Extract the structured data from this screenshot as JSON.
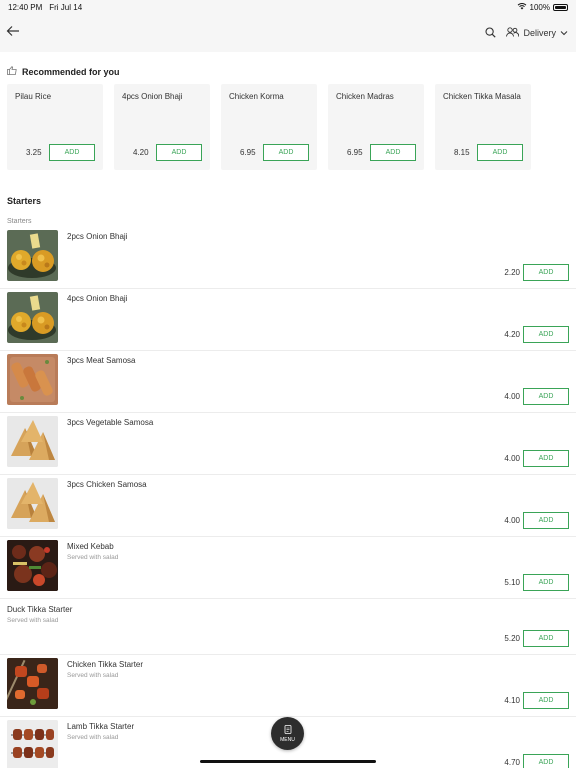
{
  "status_bar": {
    "time": "12:40 PM",
    "date": "Fri Jul 14",
    "battery": "100%",
    "battery_level": 1.0
  },
  "nav": {
    "delivery_label": "Delivery"
  },
  "recommended": {
    "title": "Recommended for you",
    "items": [
      {
        "name": "Pilau Rice",
        "price": "3.25",
        "add_label": "ADD"
      },
      {
        "name": "4pcs Onion Bhaji",
        "price": "4.20",
        "add_label": "ADD"
      },
      {
        "name": "Chicken Korma",
        "price": "6.95",
        "add_label": "ADD"
      },
      {
        "name": "Chicken Madras",
        "price": "6.95",
        "add_label": "ADD"
      },
      {
        "name": "Chicken Tikka Masala",
        "price": "8.15",
        "add_label": "ADD"
      }
    ]
  },
  "section": {
    "title": "Starters",
    "subtitle": "Starters"
  },
  "menu": [
    {
      "name": "2pcs Onion Bhaji",
      "desc": "",
      "price": "2.20",
      "add_label": "ADD",
      "image": "onion-bhaji"
    },
    {
      "name": "4pcs Onion Bhaji",
      "desc": "",
      "price": "4.20",
      "add_label": "ADD",
      "image": "onion-bhaji"
    },
    {
      "name": "3pcs Meat Samosa",
      "desc": "",
      "price": "4.00",
      "add_label": "ADD",
      "image": "meat-samosa"
    },
    {
      "name": "3pcs Vegetable Samosa",
      "desc": "",
      "price": "4.00",
      "add_label": "ADD",
      "image": "samosa"
    },
    {
      "name": "3pcs Chicken Samosa",
      "desc": "",
      "price": "4.00",
      "add_label": "ADD",
      "image": "samosa"
    },
    {
      "name": "Mixed Kebab",
      "desc": "Served with salad",
      "price": "5.10",
      "add_label": "ADD",
      "image": "kebab"
    },
    {
      "name": "Duck Tikka Starter",
      "desc": "Served with salad",
      "price": "5.20",
      "add_label": "ADD",
      "image": null
    },
    {
      "name": "Chicken Tikka Starter",
      "desc": "Served with salad",
      "price": "4.10",
      "add_label": "ADD",
      "image": "tikka"
    },
    {
      "name": "Lamb Tikka Starter",
      "desc": "Served with salad",
      "price": "4.70",
      "add_label": "ADD",
      "image": "lamb-tikka"
    }
  ],
  "fab": {
    "label": "MENU"
  },
  "colors": {
    "accent_green": "#3aa457",
    "nav_bg": "#f6f6f6",
    "card_bg": "#f5f5f5",
    "fab_bg": "#2d2d2d"
  }
}
